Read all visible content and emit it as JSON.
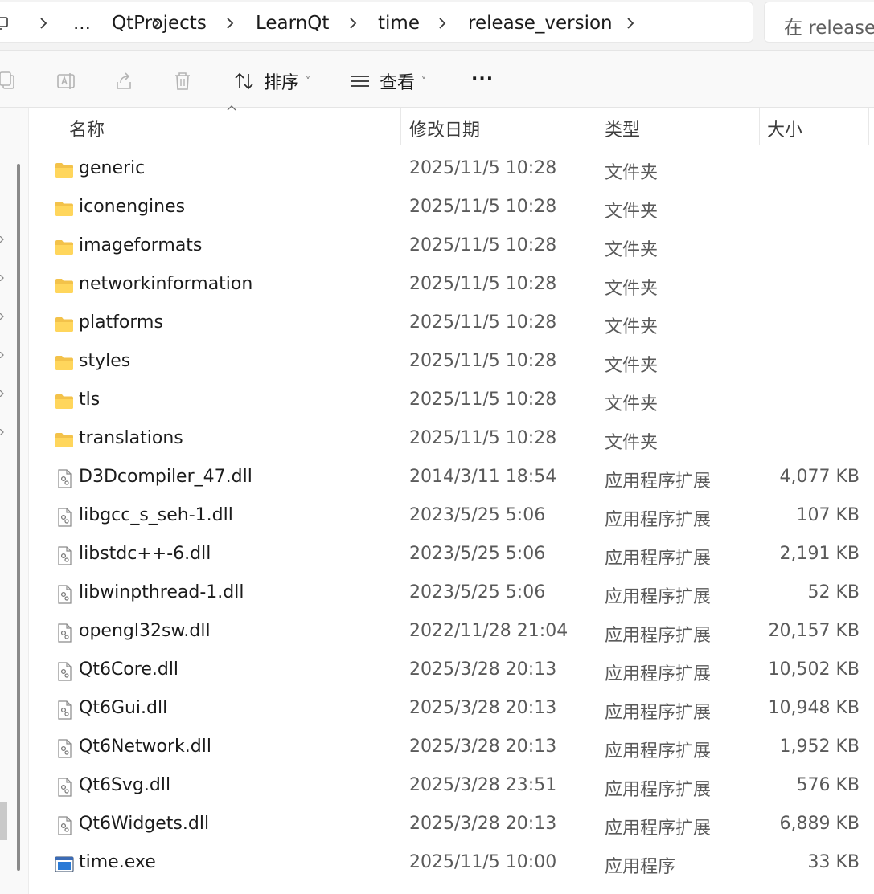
{
  "breadcrumb": {
    "items": [
      {
        "label": "...",
        "icon": "more-icon"
      },
      {
        "label": "QtProjects"
      },
      {
        "label": "LearnQt"
      },
      {
        "label": "time"
      },
      {
        "label": "release_version"
      }
    ]
  },
  "search": {
    "placeholder": "在 release_"
  },
  "toolbar": {
    "sort_label": "排序",
    "view_label": "查看",
    "more_label": "···",
    "icons": [
      "copy-icon",
      "rename-icon",
      "share-icon",
      "delete-icon",
      "sort-icon",
      "view-icon"
    ]
  },
  "columns": {
    "name": "名称",
    "modified": "修改日期",
    "type": "类型",
    "size": "大小"
  },
  "files": [
    {
      "name": "generic",
      "modified": "2025/11/5 10:28",
      "type": "文件夹",
      "size": "",
      "kind": "folder"
    },
    {
      "name": "iconengines",
      "modified": "2025/11/5 10:28",
      "type": "文件夹",
      "size": "",
      "kind": "folder"
    },
    {
      "name": "imageformats",
      "modified": "2025/11/5 10:28",
      "type": "文件夹",
      "size": "",
      "kind": "folder"
    },
    {
      "name": "networkinformation",
      "modified": "2025/11/5 10:28",
      "type": "文件夹",
      "size": "",
      "kind": "folder"
    },
    {
      "name": "platforms",
      "modified": "2025/11/5 10:28",
      "type": "文件夹",
      "size": "",
      "kind": "folder"
    },
    {
      "name": "styles",
      "modified": "2025/11/5 10:28",
      "type": "文件夹",
      "size": "",
      "kind": "folder"
    },
    {
      "name": "tls",
      "modified": "2025/11/5 10:28",
      "type": "文件夹",
      "size": "",
      "kind": "folder"
    },
    {
      "name": "translations",
      "modified": "2025/11/5 10:28",
      "type": "文件夹",
      "size": "",
      "kind": "folder"
    },
    {
      "name": "D3Dcompiler_47.dll",
      "modified": "2014/3/11 18:54",
      "type": "应用程序扩展",
      "size": "4,077 KB",
      "kind": "dll"
    },
    {
      "name": "libgcc_s_seh-1.dll",
      "modified": "2023/5/25 5:06",
      "type": "应用程序扩展",
      "size": "107 KB",
      "kind": "dll"
    },
    {
      "name": "libstdc++-6.dll",
      "modified": "2023/5/25 5:06",
      "type": "应用程序扩展",
      "size": "2,191 KB",
      "kind": "dll"
    },
    {
      "name": "libwinpthread-1.dll",
      "modified": "2023/5/25 5:06",
      "type": "应用程序扩展",
      "size": "52 KB",
      "kind": "dll"
    },
    {
      "name": "opengl32sw.dll",
      "modified": "2022/11/28 21:04",
      "type": "应用程序扩展",
      "size": "20,157 KB",
      "kind": "dll"
    },
    {
      "name": "Qt6Core.dll",
      "modified": "2025/3/28 20:13",
      "type": "应用程序扩展",
      "size": "10,502 KB",
      "kind": "dll"
    },
    {
      "name": "Qt6Gui.dll",
      "modified": "2025/3/28 20:13",
      "type": "应用程序扩展",
      "size": "10,948 KB",
      "kind": "dll"
    },
    {
      "name": "Qt6Network.dll",
      "modified": "2025/3/28 20:13",
      "type": "应用程序扩展",
      "size": "1,952 KB",
      "kind": "dll"
    },
    {
      "name": "Qt6Svg.dll",
      "modified": "2025/3/28 23:51",
      "type": "应用程序扩展",
      "size": "576 KB",
      "kind": "dll"
    },
    {
      "name": "Qt6Widgets.dll",
      "modified": "2025/3/28 20:13",
      "type": "应用程序扩展",
      "size": "6,889 KB",
      "kind": "dll"
    },
    {
      "name": "time.exe",
      "modified": "2025/11/5 10:00",
      "type": "应用程序",
      "size": "33 KB",
      "kind": "exe"
    }
  ]
}
